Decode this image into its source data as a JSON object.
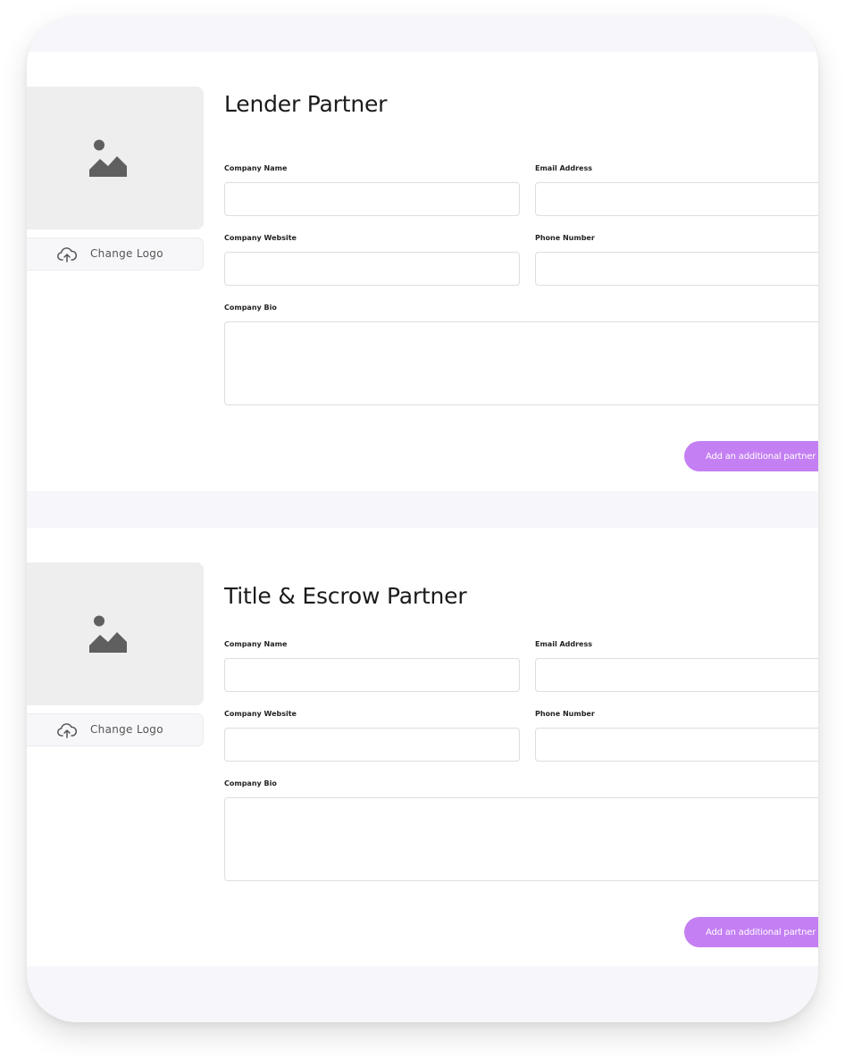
{
  "sections": [
    {
      "title": "Lender Partner",
      "change_logo_label": "Change Logo",
      "fields": {
        "company_name": {
          "label": "Company Name",
          "value": "",
          "placeholder": ""
        },
        "email_address": {
          "label": "Email Address",
          "value": "",
          "placeholder": ""
        },
        "company_website": {
          "label": "Company Website",
          "value": "",
          "placeholder": ""
        },
        "phone_number": {
          "label": "Phone Number",
          "value": "",
          "placeholder": ""
        },
        "company_bio": {
          "label": "Company Bio",
          "value": "",
          "placeholder": ""
        }
      },
      "add_button_label": "Add an additional partner"
    },
    {
      "title": "Title & Escrow Partner",
      "change_logo_label": "Change Logo",
      "fields": {
        "company_name": {
          "label": "Company Name",
          "value": "",
          "placeholder": ""
        },
        "email_address": {
          "label": "Email Address",
          "value": "",
          "placeholder": ""
        },
        "company_website": {
          "label": "Company Website",
          "value": "",
          "placeholder": ""
        },
        "phone_number": {
          "label": "Phone Number",
          "value": "",
          "placeholder": ""
        },
        "company_bio": {
          "label": "Company Bio",
          "value": "",
          "placeholder": ""
        }
      },
      "add_button_label": "Add an additional partner"
    }
  ],
  "icons": {
    "logo_placeholder": "image-placeholder-icon",
    "change_logo": "cloud-upload-icon"
  },
  "colors": {
    "accent": "#c47ff3",
    "page_background": "#f6f6fb",
    "panel_background": "#ffffff",
    "logo_placeholder_background": "#eeeeee",
    "icon_gray": "#5f5f5f"
  }
}
